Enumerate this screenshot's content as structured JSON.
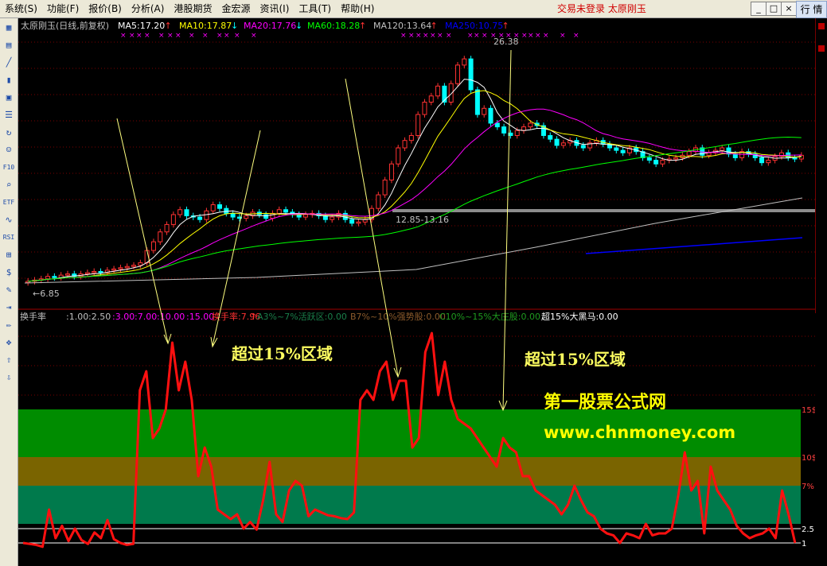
{
  "menu": {
    "items": [
      "系统(S)",
      "功能(F)",
      "报价(B)",
      "分析(A)",
      "港股期货",
      "金宏源",
      "资讯(I)",
      "工具(T)",
      "帮助(H)"
    ],
    "status": "交易未登录  太原刚玉",
    "quote_tab": "行 情",
    "window_buttons": [
      "_",
      "□",
      "×"
    ]
  },
  "toolbar": {
    "icons": [
      "grid-icon",
      "table-icon",
      "line-chart-icon",
      "candle-chart-icon",
      "window-icon",
      "list-icon",
      "refresh-icon",
      "people-icon",
      "f10-icon",
      "search-icon",
      "etf-icon",
      "wave-icon",
      "rsi-icon",
      "calc-icon",
      "dollar-icon",
      "wrench-icon",
      "export-icon",
      "pencil-icon",
      "move-icon",
      "up-arrow-icon",
      "down-arrow-icon"
    ],
    "labels": [
      "▦",
      "▤",
      "╱",
      "▮",
      "▣",
      "☰",
      "↻",
      "☺",
      "F10",
      "⌕",
      "ETF",
      "∿",
      "RSI",
      "⊞",
      "$",
      "✎",
      "⇥",
      "✏",
      "✥",
      "⇧",
      "⇩"
    ]
  },
  "price_panel": {
    "title": "太原刚玉(日线,前复权)",
    "ma": [
      {
        "label": "MA5:17.20",
        "arrow": "↑",
        "color": "#ffffff"
      },
      {
        "label": "MA10:17.87",
        "arrow": "↓",
        "color": "#ffff00"
      },
      {
        "label": "MA20:17.76",
        "arrow": "↓",
        "color": "#ff00ff"
      },
      {
        "label": "MA60:18.28",
        "arrow": "↑",
        "color": "#00ff00"
      },
      {
        "label": "MA120:13.64",
        "arrow": "↑",
        "color": "#c0c0c0"
      },
      {
        "label": "MA250:10.75",
        "arrow": "↑",
        "color": "#0000ff"
      }
    ],
    "high_label": "26.38",
    "low_label": "←6.85",
    "band_label": "12.85-13.16",
    "colors": {
      "up": "#ff3232",
      "down": "#00ffff",
      "grid": "#7a0000",
      "band": "#8c8c8c",
      "marker": "#ff00ff"
    }
  },
  "turnover_panel": {
    "header": [
      {
        "text": "换手率",
        "color": "#c0c0c0"
      },
      {
        "text": ":1.00",
        "color": "#c0c0c0"
      },
      {
        "text": ":2.50",
        "color": "#c0c0c0"
      },
      {
        "text": ":3.00",
        "color": "#ff00ff"
      },
      {
        "text": ":7.00",
        "color": "#ff00ff"
      },
      {
        "text": ":10.00",
        "color": "#ff00ff"
      },
      {
        "text": ":15.00",
        "color": "#ff00ff"
      },
      {
        "text": "换手率:7.96",
        "color": "#ff3232"
      },
      {
        "text": "↑",
        "color": "#ff3232"
      },
      {
        "text": "A3%~7%活跃区:0.00",
        "color": "#1a7f4a"
      },
      {
        "text": "B7%~10%强势股:0.00",
        "color": "#8b5a2b"
      },
      {
        "text": "C10%~15%大庄股:0.00",
        "color": "#1f9a1f"
      },
      {
        "text": "超15%大黑马:0.00",
        "color": "#ffffff"
      }
    ],
    "axis_labels": [
      "15$",
      "10$",
      "7%",
      "2.5",
      "1"
    ],
    "colors": {
      "line": "#ff1010",
      "zone_15": "#008c00",
      "zone_10": "#7a6400",
      "zone_7": "#007a4c",
      "grid": "#7a0000"
    }
  },
  "annotations": {
    "region_label_1": "超过15%区域",
    "region_label_2": "超过15%区域",
    "watermark_title": "第一股票公式网",
    "watermark_url": "www.chnmoney.com"
  },
  "chart_data": {
    "type": "line",
    "title": "换手率",
    "ylabel": "",
    "ylim": [
      0,
      25
    ],
    "zones": [
      {
        "name": "A3%~7%活跃区",
        "from": 3,
        "to": 7
      },
      {
        "name": "B7%~10%强势股",
        "from": 7,
        "to": 10
      },
      {
        "name": "C10%~15%大庄股",
        "from": 10,
        "to": 15
      }
    ],
    "series": [
      {
        "name": "换手率",
        "values": [
          1.0,
          0.9,
          0.8,
          0.6,
          4.5,
          1.5,
          2.8,
          1.2,
          2.5,
          1.3,
          0.9,
          2.1,
          1.5,
          3.4,
          1.4,
          1.0,
          0.8,
          0.9,
          17.0,
          19.0,
          12.0,
          13.0,
          15.0,
          22.0,
          17.0,
          20.0,
          16.0,
          8.0,
          11.0,
          9.0,
          4.5,
          4.0,
          3.5,
          4.0,
          2.5,
          3.2,
          2.4,
          5.5,
          9.5,
          4.0,
          3.2,
          6.5,
          7.5,
          7.0,
          3.8,
          4.5,
          4.2,
          3.9,
          3.8,
          3.6,
          3.5,
          4.2,
          16.0,
          17.0,
          16.0,
          19.0,
          20.0,
          16.0,
          18.0,
          18.0,
          11.0,
          12.0,
          21.0,
          23.0,
          16.5,
          20.0,
          16.0,
          14.0,
          13.5,
          13.0,
          12.0,
          11.0,
          10.0,
          9.0,
          12.0,
          11.0,
          10.5,
          8.0,
          8.0,
          6.5,
          6.0,
          5.5,
          5.0,
          4.0,
          5.0,
          7.0,
          5.5,
          4.2,
          3.8,
          2.5,
          2.0,
          1.8,
          1.0,
          2.0,
          1.8,
          1.5,
          3.0,
          1.8,
          2.0,
          2.0,
          2.5,
          6.0,
          10.5,
          6.5,
          7.5,
          2.0,
          9.0,
          6.5,
          5.5,
          4.5,
          2.8,
          2.0,
          1.5,
          1.8,
          2.0,
          2.5,
          1.5,
          6.5,
          4.0,
          1.0
        ]
      }
    ],
    "price_close": [
      7.0,
      7.1,
      7.2,
      7.4,
      7.3,
      7.5,
      7.6,
      7.4,
      7.6,
      7.7,
      7.8,
      7.7,
      7.9,
      8.0,
      8.1,
      8.2,
      8.3,
      8.5,
      9.5,
      10.2,
      11.0,
      11.6,
      12.4,
      12.8,
      12.3,
      12.2,
      12.0,
      12.7,
      13.2,
      12.9,
      12.5,
      12.2,
      12.1,
      12.3,
      12.6,
      12.4,
      12.1,
      12.5,
      12.8,
      12.6,
      12.4,
      12.2,
      12.4,
      12.5,
      12.3,
      12.0,
      12.2,
      12.5,
      12.0,
      11.7,
      11.8,
      12.0,
      12.9,
      14.0,
      15.2,
      16.5,
      17.8,
      18.4,
      18.8,
      20.5,
      21.5,
      22.0,
      22.8,
      21.5,
      23.0,
      24.5,
      25.0,
      22.5,
      20.5,
      21.0,
      19.8,
      19.5,
      19.0,
      18.8,
      19.2,
      19.5,
      19.8,
      19.6,
      18.8,
      18.5,
      18.0,
      18.2,
      18.4,
      18.0,
      17.8,
      18.2,
      18.4,
      18.1,
      17.8,
      17.6,
      17.4,
      17.8,
      17.5,
      17.0,
      16.8,
      16.5,
      16.8,
      16.9,
      17.0,
      17.2,
      17.5,
      17.8,
      17.2,
      17.4,
      17.6,
      17.8,
      17.3,
      17.0,
      17.5,
      17.3,
      17.0,
      16.6,
      16.8,
      17.1,
      17.4,
      17.0,
      16.9,
      17.2
    ]
  }
}
